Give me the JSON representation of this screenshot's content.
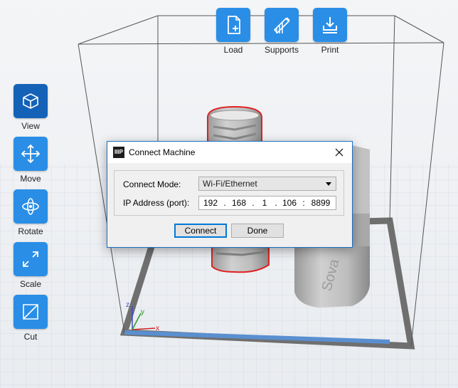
{
  "toolbar_top": {
    "load_label": "Load",
    "supports_label": "Supports",
    "print_label": "Print"
  },
  "toolbar_left": {
    "view_label": "View",
    "move_label": "Move",
    "rotate_label": "Rotate",
    "scale_label": "Scale",
    "cut_label": "Cut"
  },
  "axes": {
    "x": "x",
    "y": "y",
    "z": "z"
  },
  "dialog": {
    "app_icon": "IIIP",
    "title": "Connect Machine",
    "connect_mode_label": "Connect Mode:",
    "connect_mode_value": "Wi-Fi/Ethernet",
    "ip_label": "IP Address (port):",
    "ip_1": "192",
    "ip_2": "168",
    "ip_3": "1",
    "ip_4": "106",
    "port": "8899",
    "connect_label": "Connect",
    "done_label": "Done"
  },
  "colors": {
    "accent": "#2a8ee6",
    "accent_active": "#1462b8",
    "model": "#b7b7b7",
    "selection": "#e02020"
  }
}
